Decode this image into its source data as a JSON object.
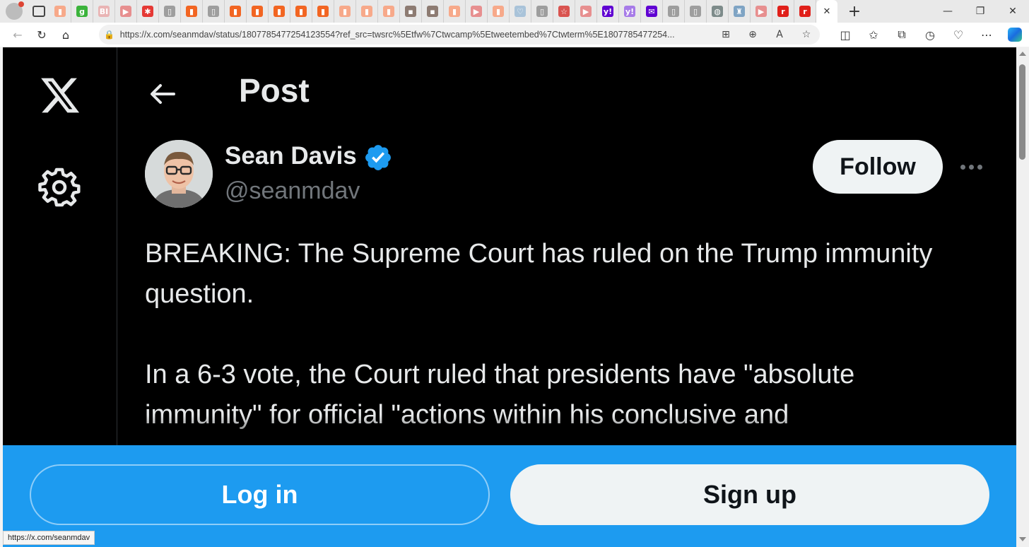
{
  "browser": {
    "tabs": [
      {
        "icon": "bookmark-icon",
        "color": "#f7a98a",
        "glyph": "▮"
      },
      {
        "icon": "g-icon",
        "color": "#3bb33b",
        "glyph": "g"
      },
      {
        "icon": "bi-icon",
        "color": "#e9b4b4",
        "glyph": "BI"
      },
      {
        "icon": "youtube-icon",
        "color": "#e78f8f",
        "glyph": "▶"
      },
      {
        "icon": "red-icon",
        "color": "#e53935",
        "glyph": "✱"
      },
      {
        "icon": "page-icon",
        "color": "#9e9e9e",
        "glyph": "▯"
      },
      {
        "icon": "bookmark-icon",
        "color": "#f26522",
        "glyph": "▮"
      },
      {
        "icon": "page-icon",
        "color": "#9e9e9e",
        "glyph": "▯"
      },
      {
        "icon": "bookmark-icon",
        "color": "#f26522",
        "glyph": "▮"
      },
      {
        "icon": "bookmark-icon",
        "color": "#f26522",
        "glyph": "▮"
      },
      {
        "icon": "bookmark-icon",
        "color": "#f26522",
        "glyph": "▮"
      },
      {
        "icon": "bookmark-icon",
        "color": "#f26522",
        "glyph": "▮"
      },
      {
        "icon": "bookmark-icon",
        "color": "#f26522",
        "glyph": "▮"
      },
      {
        "icon": "bookmark-icon",
        "color": "#f7a98a",
        "glyph": "▮"
      },
      {
        "icon": "bookmark-icon",
        "color": "#f7a98a",
        "glyph": "▮"
      },
      {
        "icon": "bookmark-icon",
        "color": "#f7a98a",
        "glyph": "▮"
      },
      {
        "icon": "photo-icon",
        "color": "#8d7b72",
        "glyph": "▪"
      },
      {
        "icon": "photo-icon",
        "color": "#8d7b72",
        "glyph": "▪"
      },
      {
        "icon": "bookmark-icon",
        "color": "#f7a98a",
        "glyph": "▮"
      },
      {
        "icon": "youtube-icon",
        "color": "#e78f8f",
        "glyph": "▶"
      },
      {
        "icon": "bookmark-icon",
        "color": "#f7a98a",
        "glyph": "▮"
      },
      {
        "icon": "heart-icon",
        "color": "#a9c3d9",
        "glyph": "♡"
      },
      {
        "icon": "page-icon",
        "color": "#9e9e9e",
        "glyph": "▯"
      },
      {
        "icon": "star-icon",
        "color": "#d9534f",
        "glyph": "☆"
      },
      {
        "icon": "youtube-icon",
        "color": "#e78f8f",
        "glyph": "▶"
      },
      {
        "icon": "yahoo-icon",
        "color": "#6001d2",
        "glyph": "y!"
      },
      {
        "icon": "yahoo-icon",
        "color": "#a77be8",
        "glyph": "y!"
      },
      {
        "icon": "mail-icon",
        "color": "#6001d2",
        "glyph": "✉"
      },
      {
        "icon": "page-icon",
        "color": "#9e9e9e",
        "glyph": "▯"
      },
      {
        "icon": "page-icon",
        "color": "#9e9e9e",
        "glyph": "▯"
      },
      {
        "icon": "globe-icon",
        "color": "#7d8b8a",
        "glyph": "◍"
      },
      {
        "icon": "castle-icon",
        "color": "#7fa4c4",
        "glyph": "♜"
      },
      {
        "icon": "youtube-icon",
        "color": "#e78f8f",
        "glyph": "▶"
      },
      {
        "icon": "r-icon",
        "color": "#e0201a",
        "glyph": "r"
      },
      {
        "icon": "r-icon",
        "color": "#e0201a",
        "glyph": "r"
      }
    ],
    "active_tab_close": "✕",
    "new_tab": "+",
    "url": "https://x.com/seanmdav/status/1807785477254123554?ref_src=twsrc%5Etfw%7Ctwcamp%5Etweetembed%7Ctwterm%5E1807785477254...",
    "status_url": "https://x.com/seanmdav"
  },
  "page": {
    "title": "Post",
    "author": {
      "name": "Sean Davis",
      "handle": "@seanmdav",
      "verified": true,
      "verified_color": "#1d9bf0"
    },
    "follow_label": "Follow",
    "post_paragraphs": [
      "BREAKING: The Supreme Court has ruled on the Trump immunity question.",
      "In a 6-3 vote, the Court ruled that presidents have \"absolute immunity\" for official \"actions within his conclusive and"
    ],
    "login_label": "Log in",
    "signup_label": "Sign up",
    "colors": {
      "background": "#000000",
      "text": "#e7e9ea",
      "muted": "#71767b",
      "brand_blue": "#1d9bf0"
    }
  }
}
